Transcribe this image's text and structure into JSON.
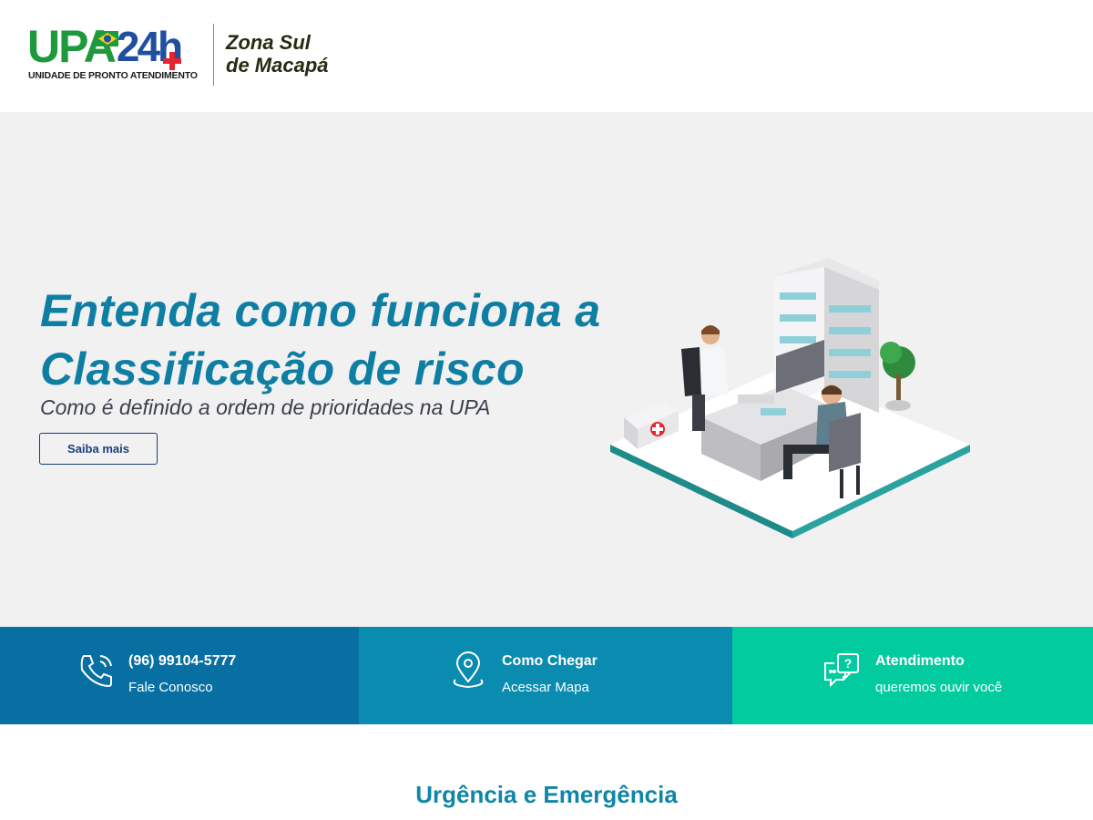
{
  "header": {
    "logo": {
      "brand_text": "UPA",
      "brand_hours": "24h",
      "tagline": "UNIDADE DE PRONTO ATENDIMENTO",
      "region": "Zona Sul de Macapá",
      "region_line1": "Zona Sul",
      "region_line2": "de Macapá"
    }
  },
  "hero": {
    "title_line1": "Entenda como funciona a",
    "title_line2": "Classificação de risco",
    "subtitle": "Como é definido a ordem de prioridades na UPA",
    "button_label": "Saiba mais",
    "illustration_icon": "doctor-consultation-illustration"
  },
  "infobar": {
    "items": [
      {
        "icon": "phone-icon",
        "title": "(96) 99104-5777",
        "text": "Fale Conosco",
        "color": "#086fa2"
      },
      {
        "icon": "map-pin-icon",
        "title": "Como Chegar",
        "text": "Acessar Mapa",
        "color": "#0a8bb0"
      },
      {
        "icon": "chat-question-icon",
        "title": "Atendimento",
        "text": "queremos ouvir você",
        "color": "#03cba0"
      }
    ]
  },
  "section": {
    "title": "Urgência e Emergência"
  },
  "colors": {
    "primary": "#0f7ea3",
    "button_border": "#1a3d7a",
    "brand_green": "#1e9a3c",
    "brand_blue": "#1f4fa0",
    "brand_red": "#e3262f"
  }
}
